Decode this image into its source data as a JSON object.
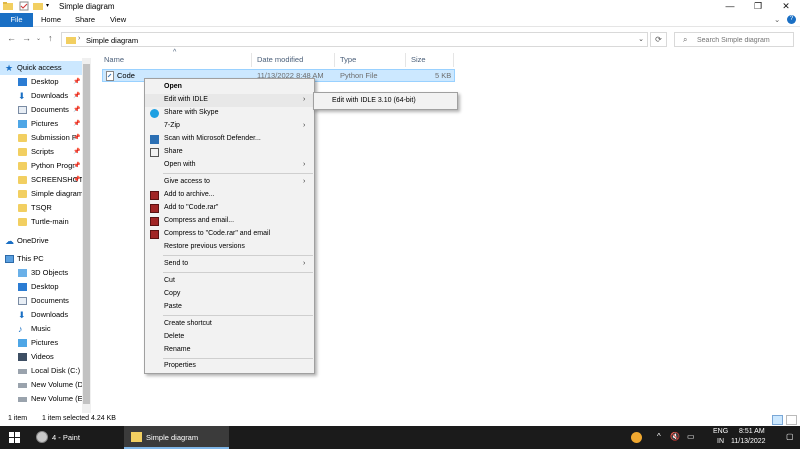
{
  "window": {
    "title": "Simple diagram",
    "controls": {
      "minimize": "—",
      "maximize": "❐",
      "close": "✕"
    }
  },
  "ribbon": {
    "tabs": [
      {
        "label": "File"
      },
      {
        "label": "Home"
      },
      {
        "label": "Share"
      },
      {
        "label": "View"
      }
    ],
    "help": "?"
  },
  "address": {
    "breadcrumb": "Simple diagram",
    "separator": "›",
    "search_placeholder": "Search Simple diagram"
  },
  "nav": {
    "quick_access": "Quick access",
    "pinned": [
      {
        "label": "Desktop",
        "icon": "desktop-icon"
      },
      {
        "label": "Downloads",
        "icon": "download-icon"
      },
      {
        "label": "Documents",
        "icon": "documents-icon"
      },
      {
        "label": "Pictures",
        "icon": "pictures-icon"
      },
      {
        "label": "Submission P",
        "icon": "folder-icon"
      },
      {
        "label": "Scripts",
        "icon": "folder-icon"
      },
      {
        "label": "Python Progr",
        "icon": "folder-icon"
      },
      {
        "label": "SCREENSHOT",
        "icon": "folder-icon"
      }
    ],
    "recent": [
      {
        "label": "Simple diagram",
        "icon": "folder-icon"
      },
      {
        "label": "TSQR",
        "icon": "folder-icon"
      },
      {
        "label": "Turtle-main",
        "icon": "folder-icon"
      }
    ],
    "onedrive": "OneDrive",
    "this_pc": "This PC",
    "pc_items": [
      {
        "label": "3D Objects",
        "icon": "cube-icon"
      },
      {
        "label": "Desktop",
        "icon": "desktop-icon"
      },
      {
        "label": "Documents",
        "icon": "documents-icon"
      },
      {
        "label": "Downloads",
        "icon": "download-icon"
      },
      {
        "label": "Music",
        "icon": "music-icon"
      },
      {
        "label": "Pictures",
        "icon": "pictures-icon"
      },
      {
        "label": "Videos",
        "icon": "videos-icon"
      },
      {
        "label": "Local Disk (C:)",
        "icon": "drive-icon"
      },
      {
        "label": "New Volume (D:",
        "icon": "drive-icon"
      },
      {
        "label": "New Volume (E:)",
        "icon": "drive-icon"
      }
    ]
  },
  "columns": {
    "name": "Name",
    "date": "Date modified",
    "type": "Type",
    "size": "Size"
  },
  "file": {
    "name": "Code",
    "date": "11/13/2022 8:48 AM",
    "type": "Python File",
    "size": "5 KB"
  },
  "context_menu": {
    "open": "Open",
    "edit_idle": "Edit with IDLE",
    "skype": "Share with Skype",
    "zip": "7-Zip",
    "defender": "Scan with Microsoft Defender...",
    "share": "Share",
    "open_with": "Open with",
    "give_access": "Give access to",
    "add_archive": "Add to archive...",
    "add_rar": "Add to \"Code.rar\"",
    "compress_email": "Compress and email...",
    "compress_rar_email": "Compress to \"Code.rar\" and email",
    "restore": "Restore previous versions",
    "send_to": "Send to",
    "cut": "Cut",
    "copy": "Copy",
    "paste": "Paste",
    "shortcut": "Create shortcut",
    "delete": "Delete",
    "rename": "Rename",
    "properties": "Properties",
    "arrow": "›"
  },
  "submenu": {
    "item": "Edit with IDLE 3.10 (64-bit)"
  },
  "status": {
    "count": "1 item",
    "selected": "1 item selected  4.24 KB"
  },
  "taskbar": {
    "paint": "4 - Paint",
    "explorer": "Simple diagram",
    "lang": "ENG",
    "region": "IN",
    "time": "8:51 AM",
    "date": "11/13/2022",
    "tray_caret": "^"
  },
  "colors": {
    "accent": "#1a6fc4",
    "selection": "#cce8ff",
    "folder": "#f2cf61",
    "taskbar": "#1b1b1b"
  }
}
